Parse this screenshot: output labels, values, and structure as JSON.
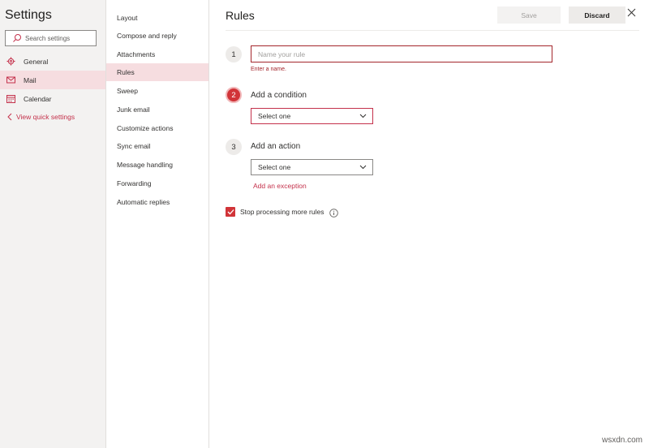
{
  "app": {
    "title": "Settings",
    "search_placeholder": "Search settings"
  },
  "left_nav": {
    "items": [
      {
        "label": "General",
        "icon": "gear-icon"
      },
      {
        "label": "Mail",
        "icon": "mail-icon",
        "active": true
      },
      {
        "label": "Calendar",
        "icon": "calendar-icon"
      }
    ],
    "quick_settings_label": "View quick settings"
  },
  "mail_nav": {
    "items": [
      {
        "label": "Layout"
      },
      {
        "label": "Compose and reply"
      },
      {
        "label": "Attachments"
      },
      {
        "label": "Rules",
        "active": true
      },
      {
        "label": "Sweep"
      },
      {
        "label": "Junk email"
      },
      {
        "label": "Customize actions"
      },
      {
        "label": "Sync email"
      },
      {
        "label": "Message handling"
      },
      {
        "label": "Forwarding"
      },
      {
        "label": "Automatic replies"
      }
    ]
  },
  "main": {
    "title": "Rules",
    "save_label": "Save",
    "discard_label": "Discard",
    "step1": {
      "number": "1",
      "placeholder": "Name your rule",
      "error": "Enter a name."
    },
    "step2": {
      "number": "2",
      "label": "Add a condition",
      "dropdown_value": "Select one"
    },
    "step3": {
      "number": "3",
      "label": "Add an action",
      "dropdown_value": "Select one"
    },
    "exception_link": "Add an exception",
    "stop_processing": {
      "label": "Stop processing more rules",
      "checked": true
    }
  },
  "watermark": "wsxdn.com",
  "colors": {
    "accent": "#c4314b",
    "error": "#a4262c",
    "active_bg": "#f6dde0",
    "pane_bg": "#f3f2f1"
  }
}
